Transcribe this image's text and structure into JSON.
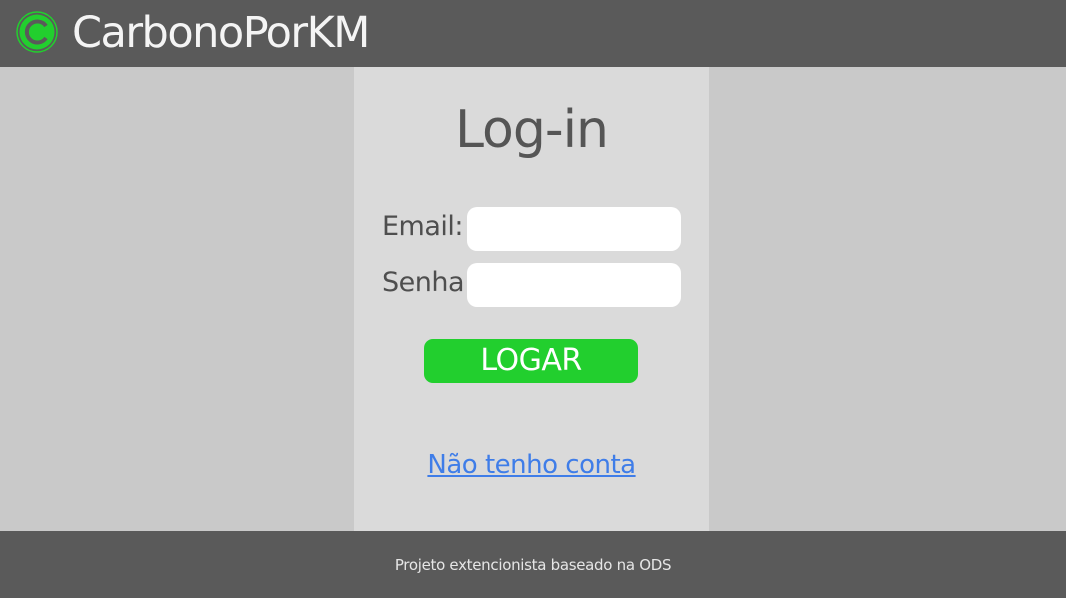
{
  "header": {
    "app_title": "CarbonoPorKM",
    "logo_icon": "carbon-logo-icon",
    "background_color": "#5a5a5a"
  },
  "login": {
    "title": "Log-in",
    "email_label": "Email:",
    "email_value": "",
    "password_label": "Senha:",
    "password_value": "",
    "submit_label": "LOGAR",
    "register_link": "Não tenho conta",
    "accent_color": "#22cf2e",
    "link_color": "#3f7de8"
  },
  "footer": {
    "text": "Projeto extencionista baseado na ODS"
  }
}
